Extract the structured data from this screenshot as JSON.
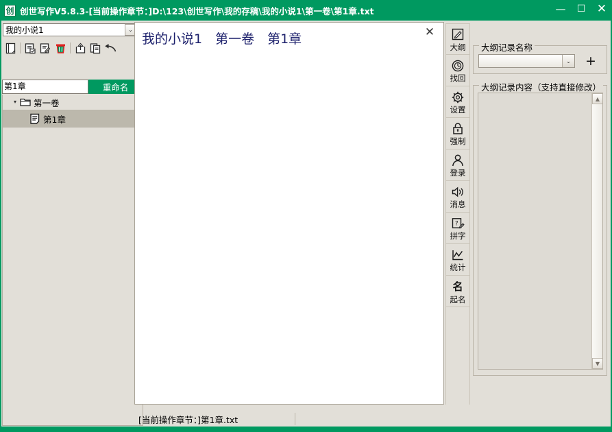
{
  "window": {
    "title": "创世写作V5.8.3-[当前操作章节：]D:\\123\\创世写作\\我的存稿\\我的小说1\\第一卷\\第1章.txt",
    "logo_glyph": "创",
    "minimize_glyph": "—",
    "maximize_glyph": "☐",
    "close_glyph": "✕",
    "accent_color": "#009960",
    "chrome_color": "#e2dfd8"
  },
  "left_panel": {
    "novel_selector": {
      "value": "我的小说1",
      "placeholder": "",
      "arrow_glyph": "⌄"
    },
    "toolbar": [
      {
        "name": "new-chapter-icon",
        "tip": "新建"
      },
      {
        "name": "save-chapter-icon",
        "tip": "保存"
      },
      {
        "name": "edit-chapter-icon",
        "tip": "编辑"
      },
      {
        "name": "delete-chapter-icon",
        "tip": "删除"
      },
      {
        "name": "export-chapter-icon",
        "tip": "导出"
      },
      {
        "name": "copy-chapter-icon",
        "tip": "复制"
      },
      {
        "name": "undo-icon",
        "tip": "撤销"
      }
    ],
    "rename": {
      "input_value": "第1章",
      "input_placeholder": "",
      "button_label": "重命名"
    },
    "tree": {
      "volume": {
        "label": "第一卷",
        "expander_glyph": "▾",
        "expanded": true
      },
      "chapters": [
        {
          "label": "第1章",
          "selected": true
        }
      ]
    }
  },
  "editor": {
    "close_glyph": "✕",
    "text": "我的小说1　第一卷　第1章",
    "text_color": "#1b1f6b"
  },
  "rail": [
    {
      "icon": "outline-pencil-icon",
      "label": "大纲"
    },
    {
      "icon": "recover-clock-icon",
      "label": "找回"
    },
    {
      "icon": "settings-gear-icon",
      "label": "设置"
    },
    {
      "icon": "lock-icon",
      "label": "强制"
    },
    {
      "icon": "user-login-icon",
      "label": "登录"
    },
    {
      "icon": "speaker-message-icon",
      "label": "消息"
    },
    {
      "icon": "spellcheck-icon",
      "label": "拼字"
    },
    {
      "icon": "statistics-chart-icon",
      "label": "统计"
    },
    {
      "icon": "naming-character-icon",
      "label": "起名"
    }
  ],
  "right_panel": {
    "name_group": {
      "title": "大纲记录名称",
      "combo_value": "",
      "combo_placeholder": "",
      "arrow_glyph": "⌄",
      "add_label": "+"
    },
    "content_group": {
      "title": "大纲记录内容（支持直接修改）",
      "textarea_value": "",
      "scroll_up_glyph": "▲",
      "scroll_down_glyph": "▼"
    }
  },
  "statusbar": {
    "left_cell": "[当前操作章节：]第1章.txt",
    "right_cell": ""
  }
}
